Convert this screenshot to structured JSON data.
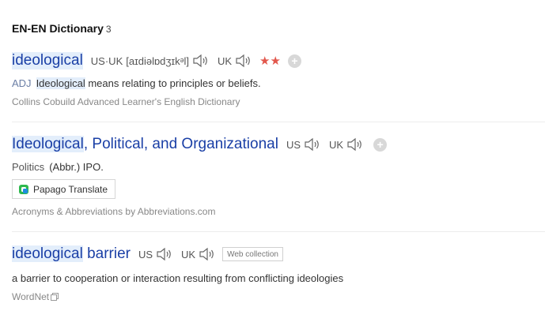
{
  "section": {
    "title": "EN-EN Dictionary",
    "count": "3"
  },
  "entries": [
    {
      "headword": "ideological",
      "us_label": "US·UK",
      "phonetic": "[aɪdiəlɒdʒɪkᵊl]",
      "uk_label": "UK",
      "stars": "★★",
      "pos": "ADJ",
      "def_highlight": "Ideological",
      "def_rest": " means relating to principles or beliefs.",
      "source": "Collins Cobuild Advanced Learner's English Dictionary"
    },
    {
      "headword_highlight": "Ideological",
      "headword_rest": ", Political, and Organizational",
      "us_label": "US",
      "uk_label": "UK",
      "subject": "Politics",
      "def": "(Abbr.) IPO.",
      "translate_button": "Papago Translate",
      "source": "Acronyms & Abbreviations by Abbreviations.com"
    },
    {
      "headword_highlight": "ideological",
      "headword_rest": " barrier",
      "us_label": "US",
      "uk_label": "UK",
      "tag": "Web collection",
      "def": "a barrier to cooperation or interaction resulting from conflicting ideologies",
      "source": "WordNet"
    }
  ],
  "icons": {
    "speaker": "speaker-icon",
    "add": "plus-circle-icon",
    "papago": "papago-logo-icon",
    "copy": "copy-icon"
  },
  "colors": {
    "headword": "#1a3fa6",
    "highlight": "#e3eefb",
    "stars": "#e2574c",
    "source": "#888888"
  }
}
